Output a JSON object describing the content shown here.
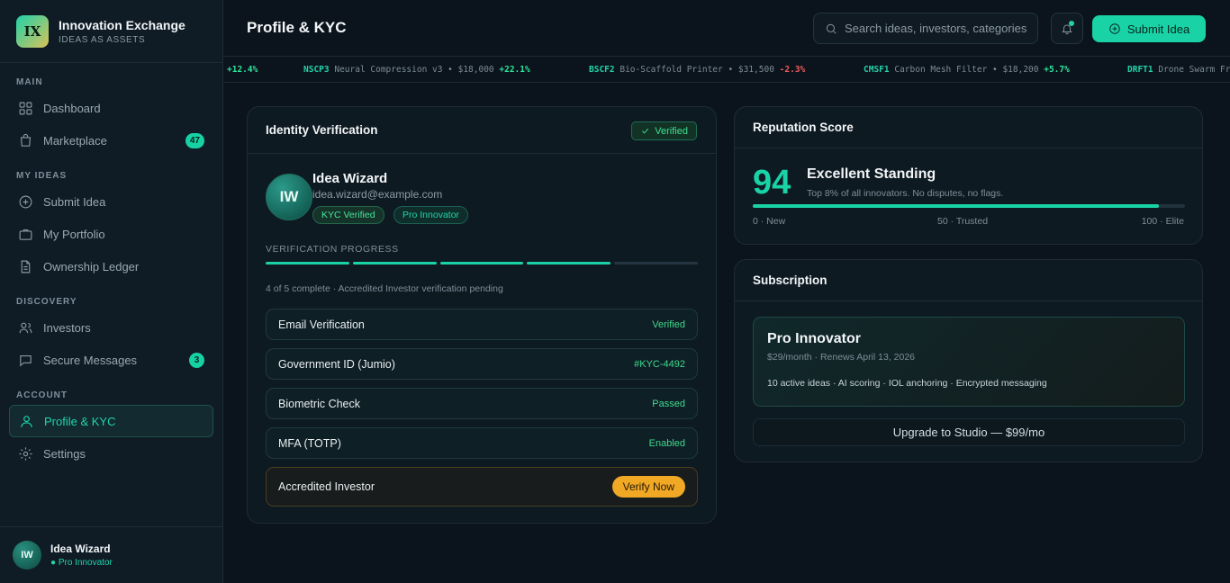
{
  "brand": {
    "logo_text": "IX",
    "name": "Innovation Exchange",
    "tagline": "IDEAS AS ASSETS"
  },
  "sidebar": {
    "sections": {
      "main": "MAIN",
      "my_ideas": "MY IDEAS",
      "discovery": "DISCOVERY",
      "account": "ACCOUNT"
    },
    "items": [
      {
        "label": "Dashboard",
        "icon": "grid-icon"
      },
      {
        "label": "Marketplace",
        "icon": "bag-icon",
        "badge": "47"
      },
      {
        "label": "Submit Idea",
        "icon": "plus-circle-icon"
      },
      {
        "label": "My Portfolio",
        "icon": "briefcase-icon"
      },
      {
        "label": "Ownership Ledger",
        "icon": "document-icon"
      },
      {
        "label": "Investors",
        "icon": "users-icon"
      },
      {
        "label": "Secure Messages",
        "icon": "message-icon",
        "badge": "3"
      },
      {
        "label": "Profile & KYC",
        "icon": "user-icon",
        "active": true
      },
      {
        "label": "Settings",
        "icon": "gear-icon"
      }
    ],
    "user": {
      "initials": "IW",
      "name": "Idea Wizard",
      "role": "● Pro Innovator"
    }
  },
  "header": {
    "title": "Profile & KYC",
    "search_placeholder": "Search ideas, investors, categories",
    "submit_label": "Submit Idea"
  },
  "ticker": [
    {
      "change": "+12.4%",
      "dir": "up"
    },
    {
      "symbol": "NSCP3",
      "desc": "Neural Compression v3 • $18,000",
      "change": "+22.1%",
      "dir": "up"
    },
    {
      "symbol": "BSCF2",
      "desc": "Bio-Scaffold Printer • $31,500",
      "change": "-2.3%",
      "dir": "down"
    },
    {
      "symbol": "CMSF1",
      "desc": "Carbon Mesh Filter • $18,200",
      "change": "+5.7%",
      "dir": "up"
    },
    {
      "symbol": "DRFT1",
      "desc": "Drone Swarm Fr",
      "change": "",
      "dir": "up"
    }
  ],
  "identity": {
    "title": "Identity Verification",
    "status_chip": "Verified",
    "initials": "IW",
    "name": "Idea Wizard",
    "email": "idea.wizard@example.com",
    "tags": [
      "KYC Verified",
      "Pro Innovator"
    ],
    "progress_label": "VERIFICATION PROGRESS",
    "progress_done": 4,
    "progress_total": 5,
    "progress_text": "4 of 5 complete · Accredited Investor verification pending",
    "checks": [
      {
        "label": "Email Verification",
        "status": "Verified"
      },
      {
        "label": "Government ID (Jumio)",
        "status": "#KYC-4492"
      },
      {
        "label": "Biometric Check",
        "status": "Passed"
      },
      {
        "label": "MFA (TOTP)",
        "status": "Enabled"
      }
    ],
    "accredited": {
      "label": "Accredited Investor",
      "button": "Verify Now"
    }
  },
  "reputation": {
    "title": "Reputation Score",
    "score": "94",
    "score_value": 94,
    "standing": "Excellent Standing",
    "subtitle": "Top 8% of all innovators. No disputes, no flags.",
    "scale": [
      "0 · New",
      "50 · Trusted",
      "100 · Elite"
    ]
  },
  "subscription": {
    "title": "Subscription",
    "plan": "Pro Innovator",
    "price": "$29/month · Renews April 13, 2026",
    "features": "10 active ideas · AI scoring · IOL anchoring · Encrypted messaging",
    "upgrade": "Upgrade to Studio — $99/mo"
  },
  "colors": {
    "accent": "#19d3a7",
    "warning": "#f0a825",
    "background": "#0b141c",
    "down": "#ef5b5b"
  }
}
